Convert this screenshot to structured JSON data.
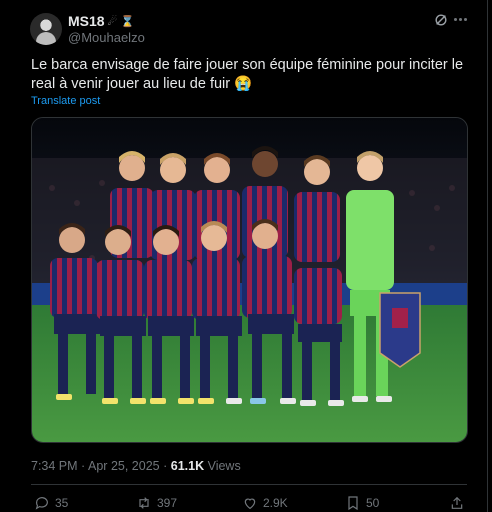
{
  "author": {
    "display_name": "MS18",
    "name_emojis": [
      "☄",
      "⌛"
    ],
    "handle": "@Mouhaelzo"
  },
  "tweet": {
    "text": "Le barca envisage de faire jouer son équipe féminine pour inciter le real à venir jouer au lieu de fuir 😭",
    "translate_label": "Translate post",
    "media_alt": "Team photo of FC Barcelona women's squad in blaugrana kit on the pitch"
  },
  "meta": {
    "time": "7:34 PM",
    "separator": "·",
    "date": "Apr 25, 2025",
    "views_count": "61.1K",
    "views_label": "Views"
  },
  "actions": {
    "replies": "35",
    "reposts": "397",
    "likes": "2.9K",
    "bookmarks": "50"
  },
  "icons": [
    "grok-icon",
    "more-icon",
    "reply-icon",
    "repost-icon",
    "like-icon",
    "bookmark-icon",
    "share-icon"
  ],
  "colors": {
    "background": "#000000",
    "text": "#e7e9ea",
    "muted": "#71767b",
    "link": "#1d9bf0",
    "kit_blue": "#1b2a6b",
    "kit_garnet": "#a2214a",
    "keeper_green": "#7ee06a",
    "pitch_green": "#3d8a3a"
  }
}
